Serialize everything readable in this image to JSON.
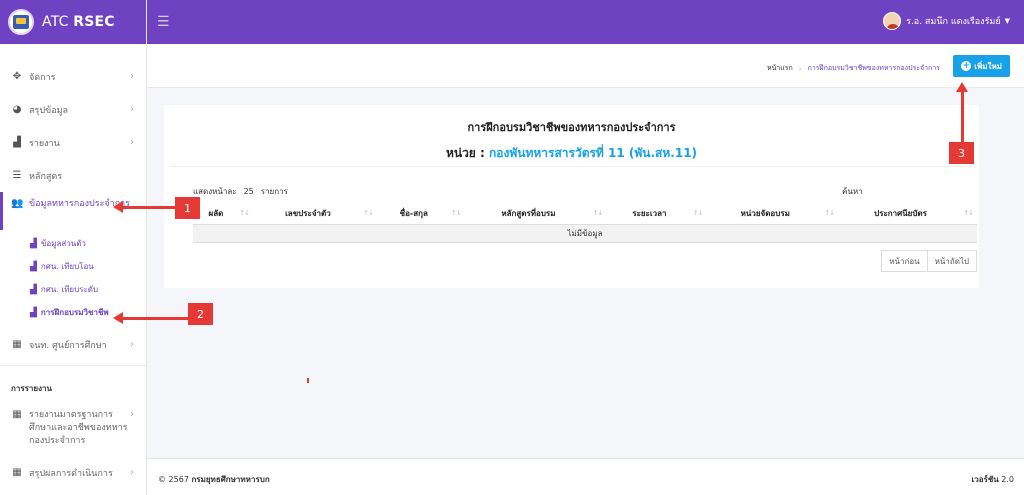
{
  "brand": {
    "name_prefix": "ATC",
    "name_bold": "RSEC"
  },
  "topbar": {
    "user_name": "ร.อ. สมนึก แดงเรืองรัมย์"
  },
  "sidebar": {
    "items": [
      {
        "label": "จัดการ",
        "icon": "move-arrows-icon"
      },
      {
        "label": "สรุปข้อมูล",
        "icon": "pie-chart-icon"
      },
      {
        "label": "รายงาน",
        "icon": "area-chart-icon"
      },
      {
        "label": "หลักสูตร",
        "icon": "list-icon"
      }
    ],
    "active": {
      "label": "ข้อมูลทหารกองประจำการ",
      "icon": "users-icon"
    },
    "subitems": [
      {
        "label": "ข้อมูลส่วนตัว"
      },
      {
        "label": "กศน. เทียบโอน"
      },
      {
        "label": "กศน. เทียบระดับ"
      },
      {
        "label": "การฝึกอบรมวิชาชีพ"
      }
    ],
    "item_training_center": {
      "label": "จนท. ศูนย์การศึกษา"
    },
    "section_title": "การรายงาน",
    "report_item": {
      "label": "รายงานมาตรฐานการศึกษาและอาชีพของทหารกองประจำการ"
    },
    "report_item2": {
      "label": "สรุปผลการดำเนินการ"
    }
  },
  "breadcrumb": {
    "home": "หน้าแรก",
    "current": "การฝึกอบรมวิชาชีพของทหารกองประจำการ"
  },
  "add_button": {
    "label": "เพิ่มใหม่"
  },
  "card": {
    "title": "การฝึกอบรมวิชาชีพของทหารกองประจำการ",
    "unit_label": "หน่วย :",
    "unit_name": "กองพันทหารสารวัตรที่ 11 (พัน.สห.11)",
    "length_prefix": "แสดงหน้าละ",
    "length_value": "25",
    "length_suffix": "รายการ",
    "search_label": "ค้นหา",
    "columns": [
      "ผลัด",
      "เลขประจำตัว",
      "ชื่อ-สกุล",
      "หลักสูตรที่อบรม",
      "ระยะเวลา",
      "หน่วยจัดอบรม",
      "ประกาศนียบัตร"
    ],
    "empty_text": "ไม่มีข้อมูล",
    "prev_label": "หน้าก่อน",
    "next_label": "หน้าถัดไป"
  },
  "footer": {
    "copyright_prefix": "© 2567",
    "org": "กรมยุทธศึกษาทหารบก",
    "version_label": "เวอร์ชัน",
    "version": "2.0"
  },
  "annotations": [
    "1",
    "2",
    "3"
  ],
  "colors": {
    "primary": "#6f42c1",
    "accent": "#17a2e8",
    "annotation": "#e53935"
  }
}
